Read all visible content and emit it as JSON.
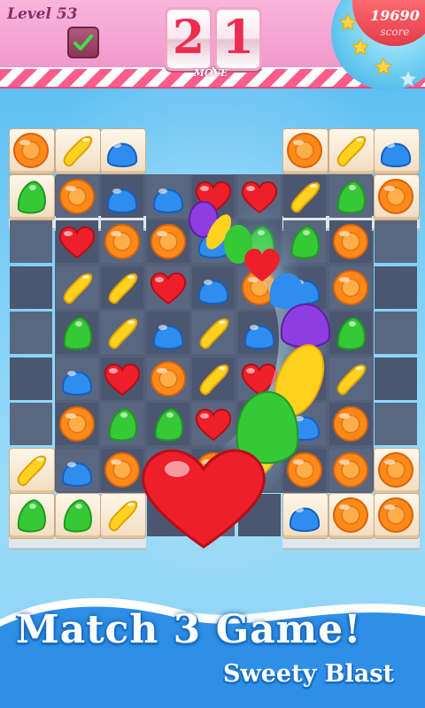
{
  "hud": {
    "level_label": "Level 53",
    "moves_digit_1": "2",
    "moves_digit_2": "1",
    "moves_label": "MOVE",
    "score_value": "19690",
    "score_label": "score",
    "stars_earned": 3,
    "stars_total": 4
  },
  "banner": {
    "title": "Match 3 Game!",
    "subtitle": "Sweety Blast"
  },
  "board": {
    "columns": 9,
    "rows": 9,
    "grid": [
      [
        "orange-candy",
        "yellow-jellybean",
        "blue-gumdrop",
        null,
        null,
        null,
        "orange-candy",
        "yellow-jellybean",
        "blue-gumdrop"
      ],
      [
        "green-gumdrop",
        "orange-candy",
        "blue-gumdrop",
        "blue-gumdrop",
        "red-heart",
        "red-heart",
        "yellow-jellybean",
        "green-gumdrop",
        "orange-candy"
      ],
      [
        null,
        "red-heart",
        "orange-candy",
        "orange-candy",
        "blue-gumdrop",
        "green-gumdrop",
        "green-gumdrop",
        "orange-candy",
        null
      ],
      [
        null,
        "yellow-jellybean",
        "yellow-jellybean",
        "red-heart",
        "blue-gumdrop",
        "orange-candy",
        "blue-gumdrop",
        "orange-candy",
        null
      ],
      [
        null,
        "green-gumdrop",
        "yellow-jellybean",
        "blue-gumdrop",
        "yellow-jellybean",
        "blue-gumdrop",
        "purple-gumdrop",
        "green-gumdrop",
        null
      ],
      [
        null,
        "blue-gumdrop",
        "red-heart",
        "orange-candy",
        "yellow-jellybean",
        "red-heart",
        "yellow-jellybean",
        "yellow-jellybean",
        null
      ],
      [
        null,
        "orange-candy",
        "green-gumdrop",
        "green-gumdrop",
        "red-heart",
        "green-gumdrop",
        "blue-gumdrop",
        "orange-candy",
        null
      ],
      [
        "yellow-jellybean",
        "blue-gumdrop",
        "orange-candy",
        "red-heart",
        "orange-candy",
        "yellow-jellybean",
        "orange-candy",
        "orange-candy",
        "orange-candy"
      ],
      [
        "green-gumdrop",
        "green-gumdrop",
        "yellow-jellybean",
        null,
        null,
        null,
        "blue-gumdrop",
        "orange-candy",
        "orange-candy"
      ]
    ]
  },
  "colors": {
    "orange": "#ff8a1a",
    "yellow": "#ffd21f",
    "blue": "#2f8df0",
    "green": "#37c837",
    "red": "#ee1f2a",
    "purple": "#8e3ee0"
  }
}
